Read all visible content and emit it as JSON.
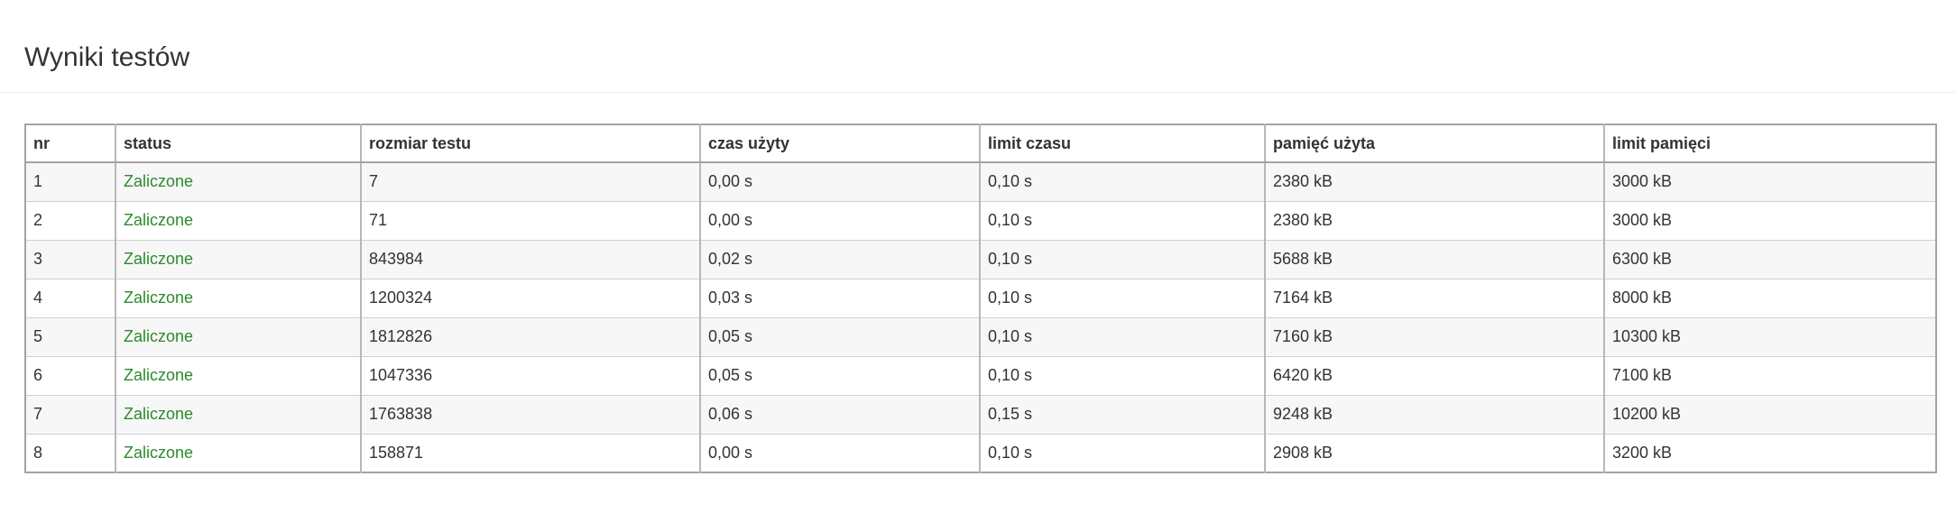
{
  "page": {
    "title": "Wyniki testów"
  },
  "table": {
    "headers": {
      "nr": "nr",
      "status": "status",
      "size": "rozmiar testu",
      "time_used": "czas użyty",
      "time_limit": "limit czasu",
      "memory_used": "pamięć użyta",
      "memory_limit": "limit pamięci"
    },
    "rows": [
      {
        "nr": "1",
        "status": "Zaliczone",
        "size": "7",
        "time_used": "0,00 s",
        "time_limit": "0,10 s",
        "memory_used": "2380 kB",
        "memory_limit": "3000 kB"
      },
      {
        "nr": "2",
        "status": "Zaliczone",
        "size": "71",
        "time_used": "0,00 s",
        "time_limit": "0,10 s",
        "memory_used": "2380 kB",
        "memory_limit": "3000 kB"
      },
      {
        "nr": "3",
        "status": "Zaliczone",
        "size": "843984",
        "time_used": "0,02 s",
        "time_limit": "0,10 s",
        "memory_used": "5688 kB",
        "memory_limit": "6300 kB"
      },
      {
        "nr": "4",
        "status": "Zaliczone",
        "size": "1200324",
        "time_used": "0,03 s",
        "time_limit": "0,10 s",
        "memory_used": "7164 kB",
        "memory_limit": "8000 kB"
      },
      {
        "nr": "5",
        "status": "Zaliczone",
        "size": "1812826",
        "time_used": "0,05 s",
        "time_limit": "0,10 s",
        "memory_used": "7160 kB",
        "memory_limit": "10300 kB"
      },
      {
        "nr": "6",
        "status": "Zaliczone",
        "size": "1047336",
        "time_used": "0,05 s",
        "time_limit": "0,10 s",
        "memory_used": "6420 kB",
        "memory_limit": "7100 kB"
      },
      {
        "nr": "7",
        "status": "Zaliczone",
        "size": "1763838",
        "time_used": "0,06 s",
        "time_limit": "0,15 s",
        "memory_used": "9248 kB",
        "memory_limit": "10200 kB"
      },
      {
        "nr": "8",
        "status": "Zaliczone",
        "size": "158871",
        "time_used": "0,00 s",
        "time_limit": "0,10 s",
        "memory_used": "2908 kB",
        "memory_limit": "3200 kB"
      }
    ]
  },
  "colors": {
    "status_pass": "#2c8a2c",
    "row_stripe": "#f7f7f7",
    "border": "#a3a3a3"
  }
}
